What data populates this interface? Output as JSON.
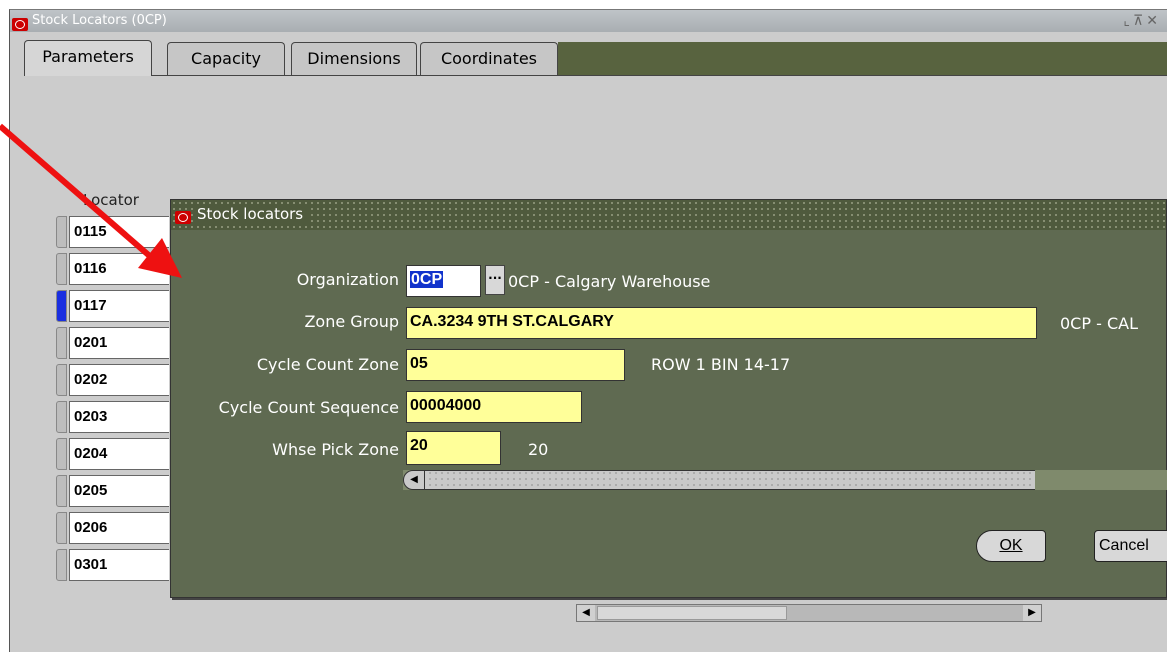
{
  "main_window": {
    "title": "Stock Locators (0CP)",
    "controls": "⌞⊼✕"
  },
  "tabs": [
    {
      "label": "Parameters"
    },
    {
      "label": "Capacity"
    },
    {
      "label": "Dimensions"
    },
    {
      "label": "Coordinates"
    }
  ],
  "grid": {
    "locator_header": "Locator",
    "locators": [
      "0115",
      "0116",
      "0117",
      "0201",
      "0202",
      "0203",
      "0204",
      "0205",
      "0206",
      "0301"
    ]
  },
  "dialog": {
    "title": "Stock locators",
    "organization": {
      "label": "Organization",
      "value": "0CP",
      "description": "0CP - Calgary Warehouse"
    },
    "zone_group": {
      "label": "Zone Group",
      "value": "CA.3234 9TH ST.CALGARY",
      "description": "0CP - CAL"
    },
    "cycle_count_zone": {
      "label": "Cycle Count Zone",
      "value": "05",
      "description": "ROW 1 BIN 14-17"
    },
    "cycle_count_sequence": {
      "label": "Cycle Count Sequence",
      "value": "00004000"
    },
    "whse_pick_zone": {
      "label": "Whse Pick Zone",
      "value": "20",
      "description": "20"
    },
    "ok_label": "OK",
    "cancel_label": "Cancel"
  },
  "colors": {
    "annotation_arrow": "#ee1111",
    "dialog_bg": "#5f6a51",
    "field_bg": "#ffff99",
    "oracle_red": "#cc0000"
  }
}
